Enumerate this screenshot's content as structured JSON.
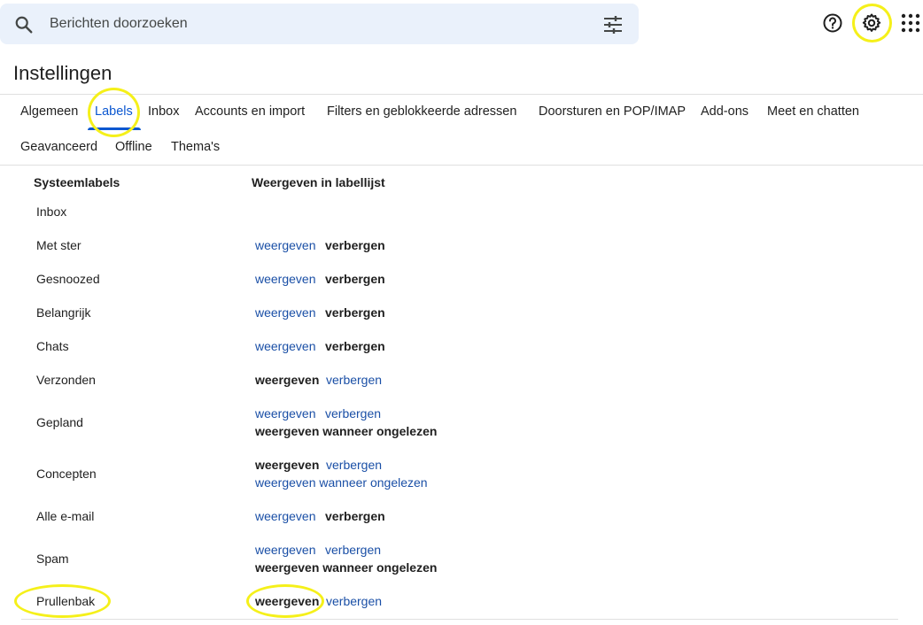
{
  "search": {
    "placeholder": "Berichten doorzoeken",
    "search_icon": "search-icon",
    "filter_icon": "tune-icon"
  },
  "toolbar": {
    "help_icon": "help-icon",
    "settings_icon": "gear-icon",
    "apps_icon": "apps-grid-icon"
  },
  "page_title": "Instellingen",
  "tabs": [
    {
      "label": "Algemeen"
    },
    {
      "label": "Labels",
      "active": true
    },
    {
      "label": "Inbox"
    },
    {
      "label": "Accounts en import"
    },
    {
      "label": "Filters en geblokkeerde adressen"
    },
    {
      "label": "Doorsturen en POP/IMAP"
    },
    {
      "label": "Add-ons"
    },
    {
      "label": "Meet en chatten"
    },
    {
      "label": "Geavanceerd"
    },
    {
      "label": "Offline"
    },
    {
      "label": "Thema's"
    }
  ],
  "table": {
    "col_system_labels": "Systeemlabels",
    "col_show_in_list": "Weergeven in labellijst",
    "rows": [
      {
        "name": "Inbox",
        "options": []
      },
      {
        "name": "Met ster",
        "options": [
          {
            "text": "weergeven",
            "selected": false
          },
          {
            "text": "verbergen",
            "selected": true
          }
        ]
      },
      {
        "name": "Gesnoozed",
        "options": [
          {
            "text": "weergeven",
            "selected": false
          },
          {
            "text": "verbergen",
            "selected": true
          }
        ]
      },
      {
        "name": "Belangrijk",
        "options": [
          {
            "text": "weergeven",
            "selected": false
          },
          {
            "text": "verbergen",
            "selected": true
          }
        ]
      },
      {
        "name": "Chats",
        "options": [
          {
            "text": "weergeven",
            "selected": false
          },
          {
            "text": "verbergen",
            "selected": true
          }
        ]
      },
      {
        "name": "Verzonden",
        "options": [
          {
            "text": "weergeven",
            "selected": true
          },
          {
            "text": "verbergen",
            "selected": false
          }
        ]
      },
      {
        "name": "Gepland",
        "options": [
          {
            "text": "weergeven",
            "selected": false
          },
          {
            "text": "verbergen",
            "selected": false
          },
          {
            "text": "weergeven wanneer ongelezen",
            "selected": true
          }
        ]
      },
      {
        "name": "Concepten",
        "options": [
          {
            "text": "weergeven",
            "selected": true
          },
          {
            "text": "verbergen",
            "selected": false
          },
          {
            "text": "weergeven wanneer ongelezen",
            "selected": false
          }
        ]
      },
      {
        "name": "Alle e-mail",
        "options": [
          {
            "text": "weergeven",
            "selected": false
          },
          {
            "text": "verbergen",
            "selected": true
          }
        ]
      },
      {
        "name": "Spam",
        "options": [
          {
            "text": "weergeven",
            "selected": false
          },
          {
            "text": "verbergen",
            "selected": false
          },
          {
            "text": "weergeven wanneer ongelezen",
            "selected": true
          }
        ]
      },
      {
        "name": "Prullenbak",
        "options": [
          {
            "text": "weergeven",
            "selected": true
          },
          {
            "text": "verbergen",
            "selected": false
          }
        ]
      }
    ]
  },
  "colors": {
    "accent": "#0b57d0",
    "link": "#1a4fa6",
    "highlight_annotation": "#f5f01a",
    "search_bg": "#eaf1fb"
  }
}
